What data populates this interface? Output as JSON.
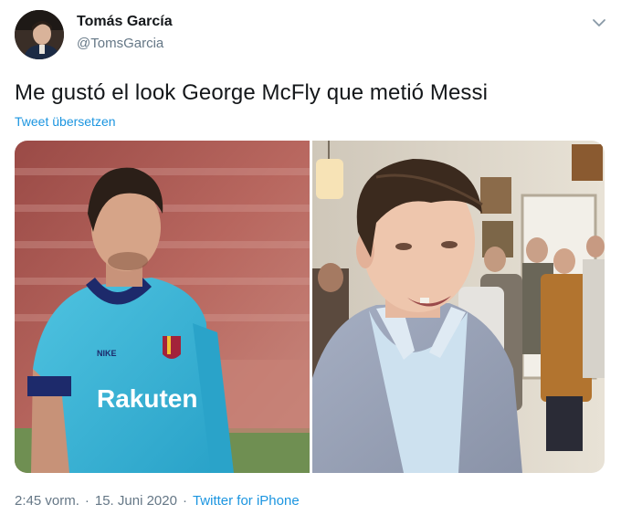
{
  "author": {
    "display_name": "Tomás García",
    "handle": "@TomsGarcia",
    "avatar_icon": "profile-photo"
  },
  "tweet": {
    "text": "Me gustó el look George McFly que metió Messi",
    "translate_label": "Tweet übersetzen"
  },
  "media": {
    "left_jersey_sponsor": "Rakuten",
    "left_jersey_brand": "NIKE"
  },
  "meta": {
    "time": "2:45 vorm.",
    "separator": "·",
    "date": "15. Juni 2020",
    "separator2": "·",
    "source": "Twitter for iPhone"
  },
  "colors": {
    "link": "#1b95e0",
    "muted": "#657786",
    "text": "#14171a"
  }
}
